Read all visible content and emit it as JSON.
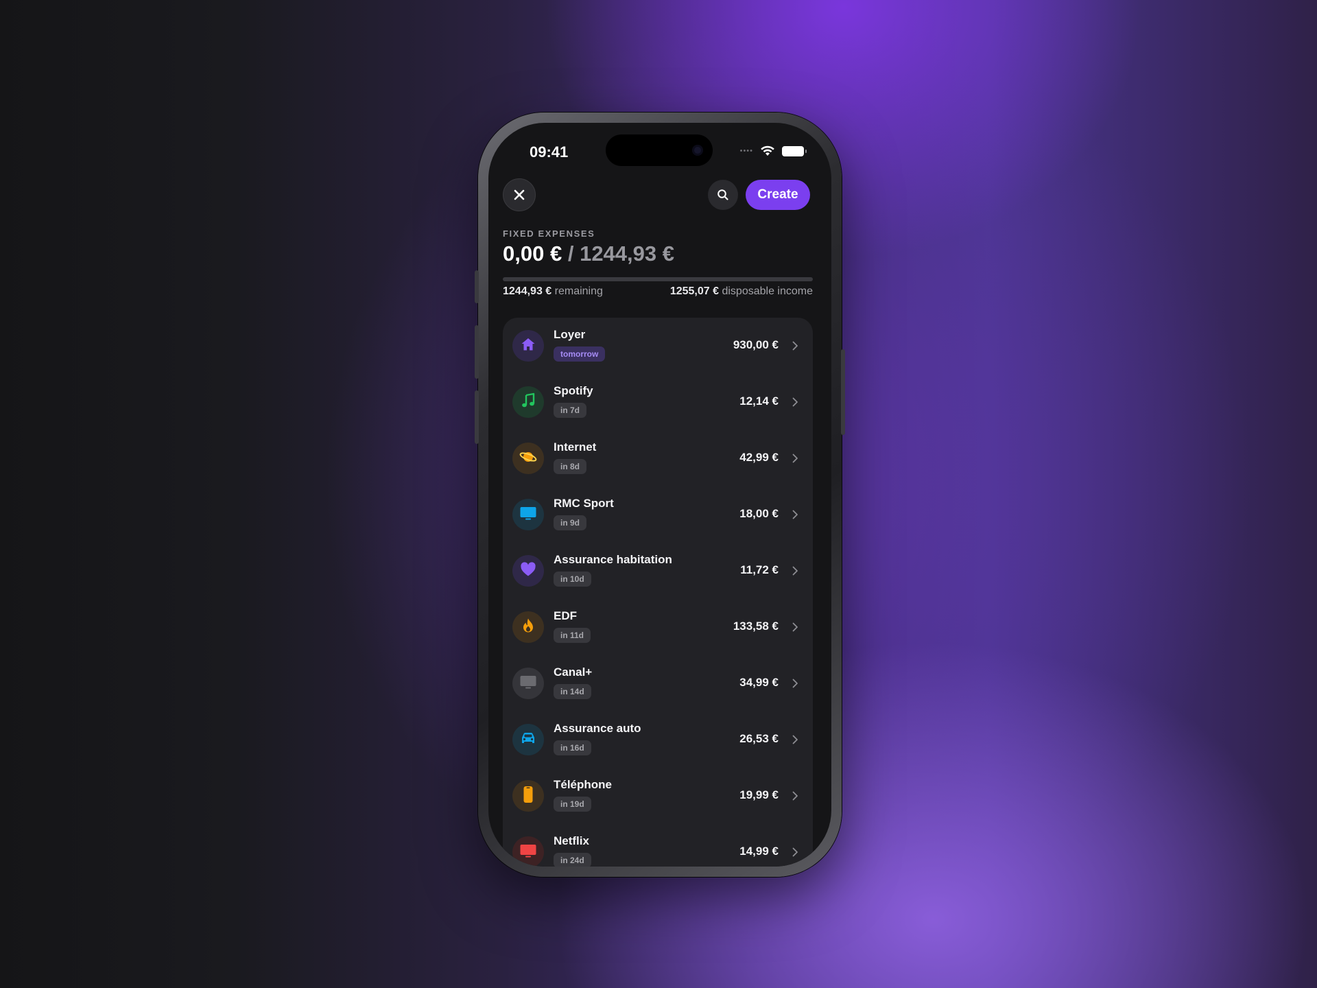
{
  "status_bar": {
    "time": "09:41",
    "signal": "••••"
  },
  "header": {
    "create_label": "Create"
  },
  "summary": {
    "section_label": "FIXED EXPENSES",
    "paid": "0,00 €",
    "separator": "/",
    "total": "1244,93 €",
    "progress_fraction": 0,
    "remaining_value": "1244,93 €",
    "remaining_label": "remaining",
    "disposable_value": "1255,07 €",
    "disposable_label": "disposable income"
  },
  "colors": {
    "accent": "#7b3fef",
    "background": "#151517",
    "card": "#222226"
  },
  "expenses": [
    {
      "name": "Loyer",
      "due": "tomorrow",
      "amount": "930,00 €",
      "icon": "house-icon",
      "icon_color": "#8b5cf6",
      "icon_bg": "#2f2848"
    },
    {
      "name": "Spotify",
      "due": "in 7d",
      "amount": "12,14 €",
      "icon": "music-note-icon",
      "icon_color": "#22c55e",
      "icon_bg": "#1f3a2c"
    },
    {
      "name": "Internet",
      "due": "in 8d",
      "amount": "42,99 €",
      "icon": "planet-icon",
      "icon_color": "#f59e0b",
      "icon_bg": "#3d3020"
    },
    {
      "name": "RMC Sport",
      "due": "in 9d",
      "amount": "18,00 €",
      "icon": "tv-icon",
      "icon_color": "#0ea5e9",
      "icon_bg": "#1d3440"
    },
    {
      "name": "Assurance habitation",
      "due": "in 10d",
      "amount": "11,72 €",
      "icon": "heart-icon",
      "icon_color": "#8b5cf6",
      "icon_bg": "#2f2848"
    },
    {
      "name": "EDF",
      "due": "in 11d",
      "amount": "133,58 €",
      "icon": "flame-icon",
      "icon_color": "#f59e0b",
      "icon_bg": "#3d3020"
    },
    {
      "name": "Canal+",
      "due": "in 14d",
      "amount": "34,99 €",
      "icon": "tv-icon",
      "icon_color": "#6b6b70",
      "icon_bg": "#35353a"
    },
    {
      "name": "Assurance auto",
      "due": "in 16d",
      "amount": "26,53 €",
      "icon": "car-icon",
      "icon_color": "#0ea5e9",
      "icon_bg": "#1d3440"
    },
    {
      "name": "Téléphone",
      "due": "in 19d",
      "amount": "19,99 €",
      "icon": "phone-icon",
      "icon_color": "#f59e0b",
      "icon_bg": "#3d3020"
    },
    {
      "name": "Netflix",
      "due": "in 24d",
      "amount": "14,99 €",
      "icon": "tv-icon",
      "icon_color": "#ef4444",
      "icon_bg": "#3d2224"
    }
  ]
}
